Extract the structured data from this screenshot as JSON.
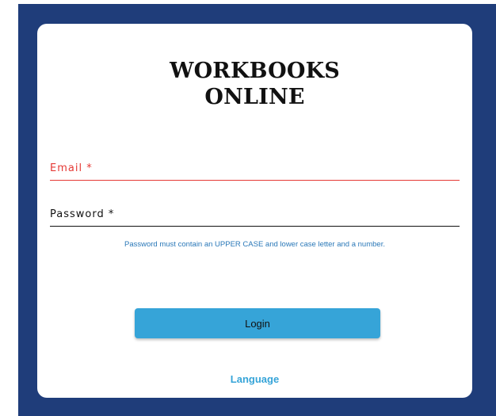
{
  "logo": {
    "line1": "WORKBOOKS",
    "line2": "ONLINE"
  },
  "form": {
    "email": {
      "label": "Email *",
      "value": "",
      "placeholder": ""
    },
    "password": {
      "label": "Password *",
      "value": "",
      "placeholder": ""
    },
    "hint": "Password must contain an UPPER CASE and lower case letter and a number.",
    "login_label": "Login",
    "language_label": "Language"
  },
  "colors": {
    "background": "#1f3d7a",
    "card": "#ffffff",
    "error": "#e53935",
    "accent": "#36a4d8",
    "hint": "#2a78b8"
  }
}
